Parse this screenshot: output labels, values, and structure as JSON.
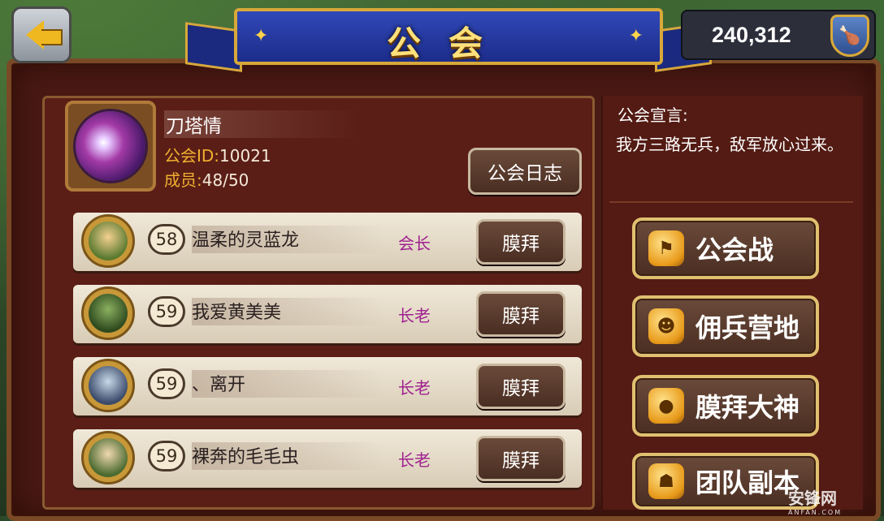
{
  "header": {
    "title": "公会",
    "currency_value": "240,312",
    "currency_icon": "drumstick-shield-icon",
    "back_icon": "back-arrow-icon"
  },
  "guild": {
    "name": "刀塔情",
    "id_label": "公会ID:",
    "id_value": "10021",
    "members_label": "成员:",
    "members_value": "48/50",
    "log_button": "公会日志"
  },
  "members": [
    {
      "level": "58",
      "name": "温柔的灵蓝龙",
      "role": "会长",
      "action": "膜拜"
    },
    {
      "level": "59",
      "name": "我爱黄美美",
      "role": "长老",
      "action": "膜拜"
    },
    {
      "level": "59",
      "name": "、离开",
      "role": "长老",
      "action": "膜拜"
    },
    {
      "level": "59",
      "name": "裸奔的毛毛虫",
      "role": "长老",
      "action": "膜拜"
    }
  ],
  "declaration": {
    "label": "公会宣言:",
    "text": "我方三路无兵，敌军放心过来。"
  },
  "side_buttons": [
    {
      "label": "公会战",
      "icon": "flag-drum-icon"
    },
    {
      "label": "佣兵营地",
      "icon": "mercenary-icon"
    },
    {
      "label": "膜拜大神",
      "icon": "worship-coin-icon"
    },
    {
      "label": "团队副本",
      "icon": "team-dungeon-icon"
    }
  ],
  "watermark": {
    "text": "安锋网",
    "sub": "ANFAN.COM"
  }
}
